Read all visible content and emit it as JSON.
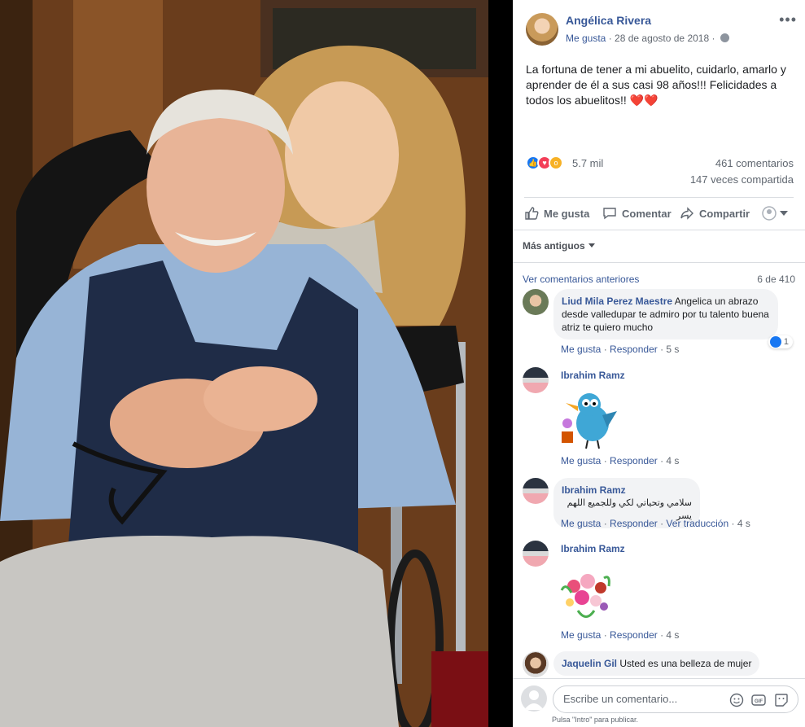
{
  "post": {
    "author": "Angélica Rivera",
    "like_page": "Me gusta",
    "separator": " · ",
    "date": "28 de agosto de 2018",
    "separator2": " · ",
    "text": "La fortuna de tener a mi abuelito, cuidarlo, amarlo y aprender de él a sus casi 98 años!!! Felicidades a todos los abuelitos!! ❤️❤️",
    "more_icon": "more-dots-icon",
    "privacy_icon": "globe-icon"
  },
  "reactions": {
    "count": "5.7 mil",
    "comments": "461 comentarios",
    "shares": "147 veces compartida",
    "icons": [
      "like-reaction-icon",
      "love-reaction-icon",
      "wow-reaction-icon"
    ]
  },
  "actions": {
    "like": "Me gusta",
    "comment": "Comentar",
    "share": "Compartir"
  },
  "sort": {
    "label": "Más antiguos"
  },
  "comments_header": {
    "previous": "Ver comentarios anteriores",
    "count": "6 de 410"
  },
  "comments": [
    {
      "name": "Liud Mila Perez Maestre",
      "text": "Angelica un abrazo desde valledupar te admiro por tu talento buena atriz te quiero mucho",
      "like": "Me gusta",
      "reply": "Responder",
      "time": "5 s",
      "reactions": "1"
    },
    {
      "name": "Ibrahim Ramz",
      "sticker": "bird-with-flower-sticker",
      "like": "Me gusta",
      "reply": "Responder",
      "time": "4 s"
    },
    {
      "name": "Ibrahim Ramz",
      "text": "سلامي وتحياتي لكي وللجميع اللهم يسر",
      "like": "Me gusta",
      "reply": "Responder",
      "translate": "Ver traducción",
      "time": "4 s"
    },
    {
      "name": "Ibrahim Ramz",
      "sticker": "flower-bouquet-sticker",
      "like": "Me gusta",
      "reply": "Responder",
      "time": "4 s"
    },
    {
      "name": "Jaquelin Gil",
      "text": "Usted es una belleza de mujer"
    }
  ],
  "compose": {
    "placeholder": "Escribe un comentario...",
    "hint": "Pulsa \"Intro\" para publicar."
  },
  "colors": {
    "link": "#385898",
    "muted": "#606770",
    "bubble": "#f2f3f5",
    "like_blue": "#1877f2",
    "love_red": "#f33e58",
    "wow_yellow": "#f7b125"
  }
}
